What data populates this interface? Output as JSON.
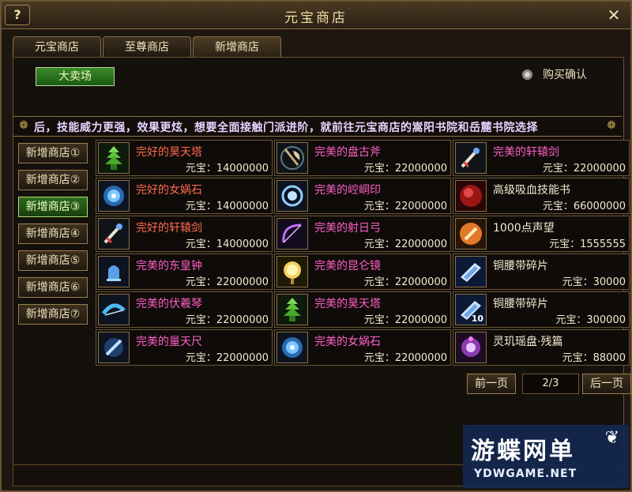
{
  "window": {
    "title": "元宝商店",
    "help": "?",
    "close": "✕"
  },
  "tabs": [
    {
      "label": "元宝商店"
    },
    {
      "label": "至尊商店"
    },
    {
      "label": "新增商店"
    }
  ],
  "auction_button": "大卖场",
  "purchase_confirm": {
    "label": "购买确认"
  },
  "marquee": "后，技能威力更强，效果更炫，想要全面接触门派进阶，就前往元宝商店的嵩阳书院和岳麓书院选择",
  "side_tabs": [
    {
      "label": "新增商店①"
    },
    {
      "label": "新增商店②"
    },
    {
      "label": "新增商店③",
      "active": true
    },
    {
      "label": "新增商店④"
    },
    {
      "label": "新增商店⑤"
    },
    {
      "label": "新增商店⑥"
    },
    {
      "label": "新增商店⑦"
    }
  ],
  "items": [
    {
      "name": "完好的昊天塔",
      "price": "元宝：14000000",
      "color": "#ff6a50",
      "icon": "pagoda-icon"
    },
    {
      "name": "完美的盘古斧",
      "price": "元宝：22000000",
      "color": "#ff5fc8",
      "icon": "axe-icon"
    },
    {
      "name": "完美的轩辕剑",
      "price": "元宝：22000000",
      "color": "#ff5fc8",
      "icon": "sword-icon"
    },
    {
      "name": "完好的女娲石",
      "price": "元宝：14000000",
      "color": "#ff6a50",
      "icon": "stone-icon"
    },
    {
      "name": "完美的崆峒印",
      "price": "元宝：22000000",
      "color": "#ff5fc8",
      "icon": "seal-icon"
    },
    {
      "name": "高级吸血技能书",
      "price": "元宝：66000000",
      "color": "#f3ead0",
      "icon": "skillbook-icon"
    },
    {
      "name": "完好的轩辕剑",
      "price": "元宝：14000000",
      "color": "#ff6a50",
      "icon": "sword-icon"
    },
    {
      "name": "完美的射日弓",
      "price": "元宝：22000000",
      "color": "#ff5fc8",
      "icon": "bow-icon"
    },
    {
      "name": "1000点声望",
      "price": "元宝：1555555",
      "color": "#f3ead0",
      "icon": "reputation-icon"
    },
    {
      "name": "完美的东皇钟",
      "price": "元宝：22000000",
      "color": "#ff5fc8",
      "icon": "bell-icon"
    },
    {
      "name": "完美的昆仑镜",
      "price": "元宝：22000000",
      "color": "#ff5fc8",
      "icon": "mirror-icon"
    },
    {
      "name": "铜腰带碎片",
      "price": "元宝：30000",
      "color": "#f3ead0",
      "icon": "belt-fragment-icon"
    },
    {
      "name": "完美的伏羲琴",
      "price": "元宝：22000000",
      "color": "#ff5fc8",
      "icon": "zither-icon"
    },
    {
      "name": "完美的昊天塔",
      "price": "元宝：22000000",
      "color": "#ff5fc8",
      "icon": "pagoda-icon"
    },
    {
      "name": "铜腰带碎片",
      "price": "元宝：300000",
      "color": "#f3ead0",
      "icon": "belt-fragment-icon",
      "qty": "10"
    },
    {
      "name": "完美的量天尺",
      "price": "元宝：22000000",
      "color": "#ff5fc8",
      "icon": "ruler-icon"
    },
    {
      "name": "完美的女娲石",
      "price": "元宝：22000000",
      "color": "#ff5fc8",
      "icon": "stone-icon"
    },
    {
      "name": "灵玑瑶盘·残篇",
      "price": "元宝：88000",
      "color": "#f3ead0",
      "icon": "disc-icon"
    }
  ],
  "pager": {
    "prev": "前一页",
    "indicator": "2/3",
    "next": "后一页"
  },
  "watermark": {
    "title": "游蝶网单",
    "url": "YDWGAME.NET"
  }
}
